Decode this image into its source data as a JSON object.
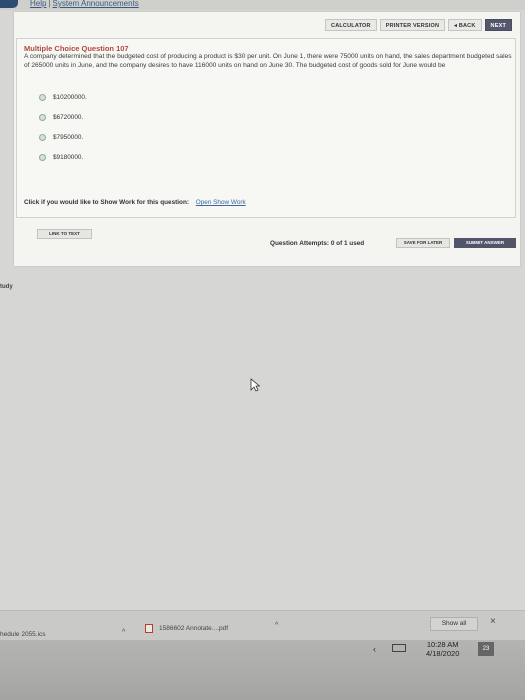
{
  "toplinks": {
    "help": "Help",
    "separator": "|",
    "announcements": "System Announcements"
  },
  "nav": {
    "calculator": "CALCULATOR",
    "printer": "PRINTER VERSION",
    "back": "◂ BACK",
    "next": "NEXT"
  },
  "question": {
    "title": "Multiple Choice Question 107",
    "text": "A company determined that the budgeted cost of producing a product is $30 per unit. On June 1, there were 75000 units on hand, the sales department budgeted sales of 265000 units in June, and the company desires to have 116000 units on hand on June 30. The budgeted cost of goods sold for June would be",
    "options": [
      "$10200000.",
      "$6720000.",
      "$7950000.",
      "$9180000."
    ]
  },
  "showwork": {
    "prompt": "Click if you would like to Show Work for this question:",
    "link": "Open Show Work"
  },
  "buttons": {
    "link_to_text": "LINK TO TEXT",
    "save_later": "SAVE FOR LATER",
    "submit": "SUBMIT ANSWER"
  },
  "attempts": "Question Attempts: 0 of 1 used",
  "side_fragment": "tudy",
  "downloads": {
    "item1": "hedule 2055.ics",
    "item2": "1586602 Annotate....pdf",
    "show_all": "Show all",
    "close": "×"
  },
  "taskbar": {
    "time": "10:28 AM",
    "date": "4/18/2020",
    "notifications": "23"
  }
}
